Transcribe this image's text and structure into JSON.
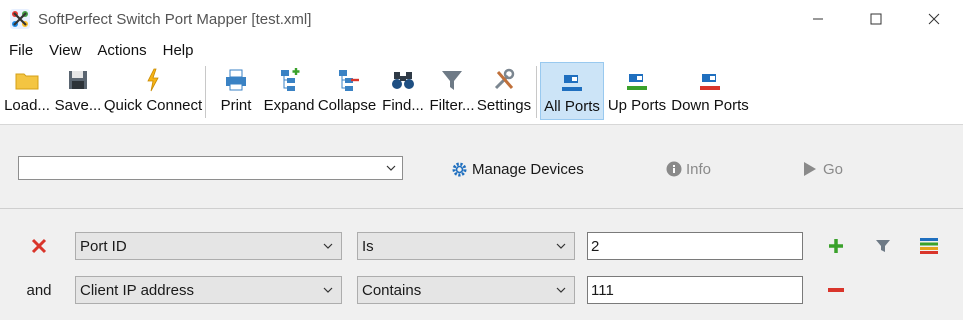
{
  "window": {
    "title": "SoftPerfect Switch Port Mapper [test.xml]"
  },
  "menu": [
    "File",
    "View",
    "Actions",
    "Help"
  ],
  "toolbar": {
    "load": "Load...",
    "save": "Save...",
    "quick_connect": "Quick Connect",
    "print": "Print",
    "expand": "Expand",
    "collapse": "Collapse",
    "find": "Find...",
    "filter": "Filter...",
    "settings": "Settings",
    "all_ports": "All Ports",
    "up_ports": "Up Ports",
    "down_ports": "Down Ports",
    "active": "all_ports"
  },
  "device": {
    "selected": "",
    "manage_devices": "Manage Devices",
    "info": "Info",
    "go": "Go"
  },
  "filters": [
    {
      "prefix_icon": "remove-x-icon",
      "field": "Port ID",
      "operator": "Is",
      "value": "2"
    },
    {
      "prefix": "and",
      "field": "Client IP address",
      "operator": "Contains",
      "value": "111"
    }
  ],
  "colors": {
    "accent_blue": "#1f6fbf",
    "active_bg": "#cce4f7",
    "add_green": "#3aa12b",
    "remove_red": "#d9352b"
  }
}
